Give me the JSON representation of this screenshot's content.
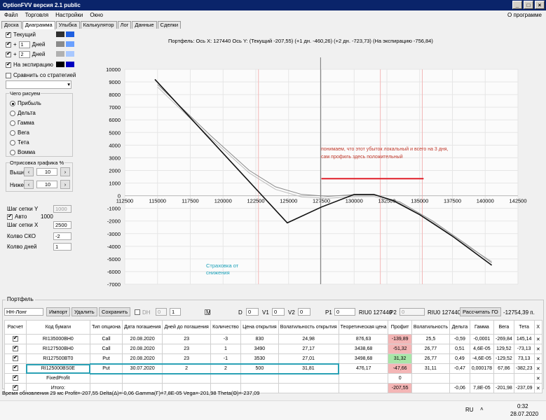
{
  "window": {
    "title": "OptionFVV версия 2.1 public"
  },
  "menu": {
    "items": [
      "Файл",
      "Торговля",
      "Настройки",
      "Окно"
    ],
    "about": "О программе"
  },
  "tabs": [
    "Доска",
    "Диаграмма",
    "Улыбка",
    "Калькулятор",
    "Лог",
    "Данные",
    "Сделки"
  ],
  "active_tab": "Диаграмма",
  "left": {
    "current_label": "Текущий",
    "days_label": "Дней",
    "days1": "1",
    "days2": "2",
    "expiry_label": "На экспирацию",
    "compare_label": "Сравнить со стратегией",
    "what_draw": "Чего рисуем",
    "options": [
      "Прибыль",
      "Дельта",
      "Гамма",
      "Вега",
      "Тета",
      "Вомма"
    ],
    "selected_option": "Прибыль",
    "range_title": "Отрисовка графика %",
    "above_label": "Выше",
    "below_label": "Ниже",
    "above_value": "10",
    "below_value": "10",
    "grid_y_label": "Шаг сетки Y",
    "grid_y_value": "1000",
    "auto_label": "Авто",
    "auto_value": "1000",
    "grid_x_label": "Шаг сетки X",
    "grid_x_value": "2500",
    "sko_label": "Колво СКО",
    "sko_value": "-2",
    "days_count_label": "Колво дней",
    "days_count_value": "1",
    "colors": {
      "current": [
        "#2f2f2f",
        "#1f5fe0"
      ],
      "d1": [
        "#8a8a8a",
        "#6aa0ff"
      ],
      "d2": [
        "#b0b0b0",
        "#a8c8ff"
      ],
      "expiry": [
        "#000000",
        "#0000c0"
      ]
    }
  },
  "chart_header": "Портфель: Ось X: 127440 Ось Y:   (Текущий -207,55)   (+1 дн. -460,26)   (+2 дн. -723,73)   (На экспирацию -756,84)",
  "annotation": {
    "text1": "понимаем, что этот убыток локальный и всего на 3 дня,",
    "text2": "сам профиль здесь положительный",
    "hedge": [
      "Страховка от",
      "снижения"
    ]
  },
  "chart_data": {
    "type": "line",
    "xlim": [
      112500,
      142500
    ],
    "ylim": [
      -7000,
      10000
    ],
    "x_ticks": [
      112500,
      115000,
      117500,
      120000,
      122500,
      125000,
      127500,
      130000,
      132500,
      135000,
      137500,
      140000,
      142500
    ],
    "y_ticks": [
      10000,
      9000,
      8000,
      7000,
      6000,
      5000,
      4000,
      3000,
      2000,
      1000,
      0,
      -1000,
      -2000,
      -3000,
      -4000,
      -5000,
      -6000,
      -7000
    ],
    "cursor_x": 127440,
    "sd_lines": [
      122700,
      132000,
      135200
    ],
    "annotation_line": {
      "x1": 127500,
      "x2": 135300,
      "y": 1350,
      "color": "#e0202a"
    },
    "series": [
      {
        "color": "#111111",
        "points": [
          [
            114800,
            9200
          ],
          [
            124900,
            -2150
          ],
          [
            127500,
            -900
          ],
          [
            130000,
            100
          ],
          [
            131500,
            100
          ],
          [
            133000,
            -400
          ],
          [
            135000,
            -1500
          ],
          [
            137500,
            -3200
          ],
          [
            140500,
            -5500
          ]
        ]
      },
      {
        "color": "#8a8a8a",
        "points": [
          [
            115000,
            8800
          ],
          [
            119000,
            4800
          ],
          [
            122000,
            2000
          ],
          [
            124000,
            700
          ],
          [
            126000,
            100
          ],
          [
            128000,
            -50
          ],
          [
            130000,
            80
          ],
          [
            131500,
            80
          ],
          [
            133500,
            -500
          ],
          [
            136000,
            -2000
          ],
          [
            138500,
            -3800
          ],
          [
            140500,
            -5300
          ]
        ]
      },
      {
        "color": "#bdbdbd",
        "points": [
          [
            115000,
            8600
          ],
          [
            119000,
            4600
          ],
          [
            122000,
            1800
          ],
          [
            124000,
            500
          ],
          [
            126000,
            -100
          ],
          [
            128000,
            -200
          ],
          [
            130000,
            -80
          ],
          [
            131500,
            -60
          ],
          [
            133500,
            -600
          ],
          [
            136000,
            -2100
          ],
          [
            138500,
            -3900
          ],
          [
            140500,
            -5200
          ]
        ]
      }
    ]
  },
  "portfolio": {
    "group_title": "Портфель",
    "select_value": "НН-Лонг",
    "import": "Импорт",
    "delete": "Удалить",
    "save": "Сохранить",
    "dh_label": "DH",
    "dh_value": "0",
    "hedge_value": "1",
    "m_label": "M",
    "d_label": "D",
    "d_value": "0",
    "v1_label": "V1",
    "v1_value": "0",
    "v2_label": "V2",
    "v2_value": "0",
    "p1_label": "P1",
    "p1_value": "0",
    "riu_label1": "RIU0 127440",
    "p2_label": "P2",
    "p2_value": "0",
    "riu_label2": "RIU0 127440",
    "calc_go": "Рассчитать ГО",
    "go_value": "-12754,39 п."
  },
  "table": {
    "headers": [
      "Расчет",
      "Код бумаги",
      "Тип опциона",
      "Дата погашения",
      "Дней до погашения",
      "Количество",
      "Цена открытия",
      "Волатильность открытия",
      "Теоретическая цена",
      "Профит",
      "Волатильность",
      "Дельта",
      "Гамма",
      "Вега",
      "Тета",
      "X"
    ],
    "rows": [
      [
        "RI135000BH0",
        "Call",
        "20.08.2020",
        "23",
        "-3",
        "830",
        "24,98",
        "876,63",
        "-139,89",
        "25,5",
        "-0,59",
        "-0,0001",
        "-269,84",
        "145,14"
      ],
      [
        "RI127500BH0",
        "Call",
        "20.08.2020",
        "23",
        "1",
        "3490",
        "27,17",
        "3438,68",
        "-51,32",
        "26,77",
        "0,51",
        "4,6E-05",
        "129,52",
        "-73,13"
      ],
      [
        "RI127500BT0",
        "Put",
        "20.08.2020",
        "23",
        "-1",
        "3530",
        "27,01",
        "3498,68",
        "31,32",
        "26,77",
        "0,49",
        "-4,6E-05",
        "-129,52",
        "73,13"
      ],
      [
        "RI125000BS0E",
        "Put",
        "30.07.2020",
        "2",
        "2",
        "500",
        "31,81",
        "476,17",
        "-47,66",
        "31,11",
        "-0,47",
        "0,000178",
        "67,86",
        "-382,23"
      ]
    ],
    "fixed_profit_label": "FixedProfit",
    "fixed_profit_value": "0",
    "total_label": "Итого:",
    "total": [
      "-207,55",
      "",
      "-0,06",
      "7,8E-05",
      "-201,98",
      "-237,09"
    ]
  },
  "status": "Время обновления 29 мс  Profit=-207,55 Delta(Δ)=-0,06 Gamma(Γ)=7,8E-05 Vega=-201,98 Theta(Θ)=-237,09",
  "taskbar": {
    "lang": "RU",
    "time": "0:32",
    "date": "28.07.2020"
  }
}
